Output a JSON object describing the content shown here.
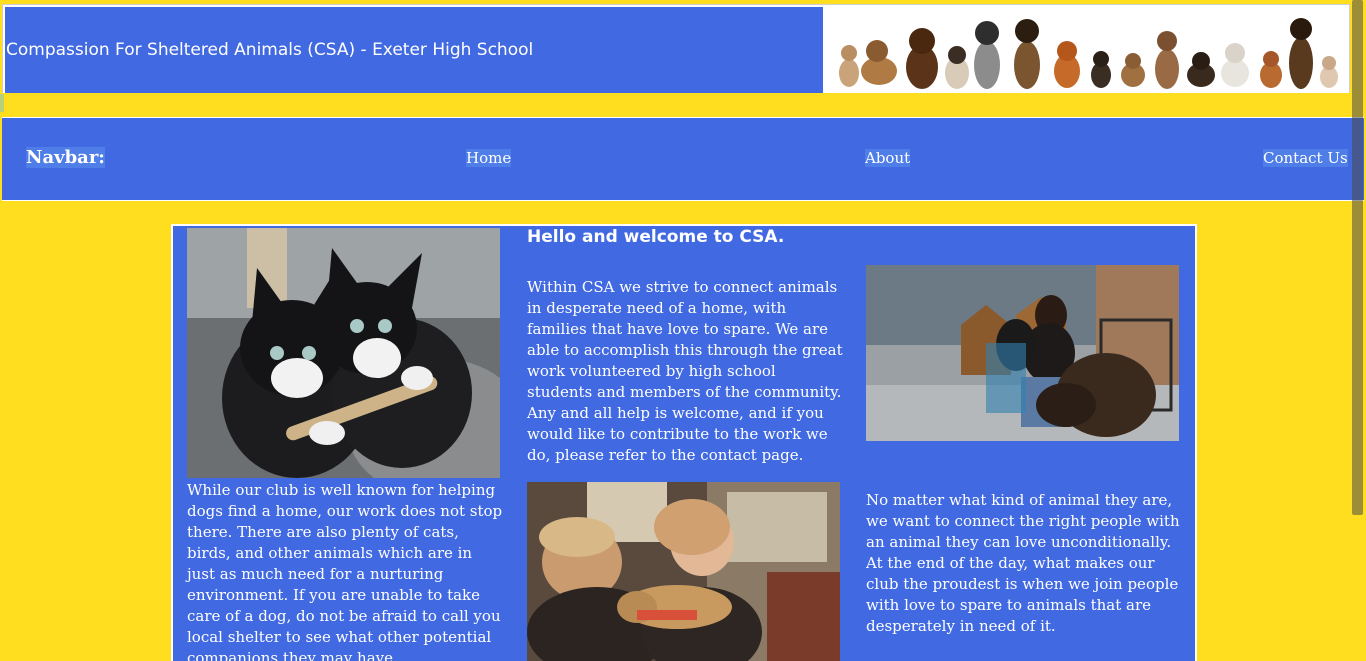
{
  "header": {
    "title": "Compassion For Sheltered Animals (CSA) - Exeter High School",
    "banner_icon": "dogs-banner-image"
  },
  "navbar": {
    "label": "Navbar:",
    "links": [
      {
        "label": "Home"
      },
      {
        "label": "About"
      },
      {
        "label": "Contact Us"
      }
    ]
  },
  "main": {
    "welcome_heading": "Hello and welcome to CSA.",
    "intro_text": "Within CSA we strive to connect animals in desperate need of a home, with families that have love to spare. We are able to accomplish this through the great work volunteered by high school students and members of the community. Any and all help is welcome, and if you would like to contribute to the work we do, please refer to the contact page.",
    "left_text": "While our club is well known for helping dogs find a home, our work does not stop there. There are also plenty of cats, birds, and other animals which are in just as much need for a nurturing environment. If you are unable to take care of a dog, do not be afraid to call you local shelter to see what other potential companions they may have.",
    "right_text": "No matter what kind of animal they are, we want to connect the right people with an animal they can love unconditionally. At the end of the day, what makes our club the proudest is when we join people with love to spare to animals that are desperately in need of it.",
    "images": {
      "kittens": "kittens-photo",
      "dog_owner": "woman-with-dog-photo",
      "volunteers": "volunteers-with-dog-photo"
    }
  },
  "colors": {
    "background": "#ffde1f",
    "accent": "#4169e1",
    "text": "#ffffff"
  }
}
